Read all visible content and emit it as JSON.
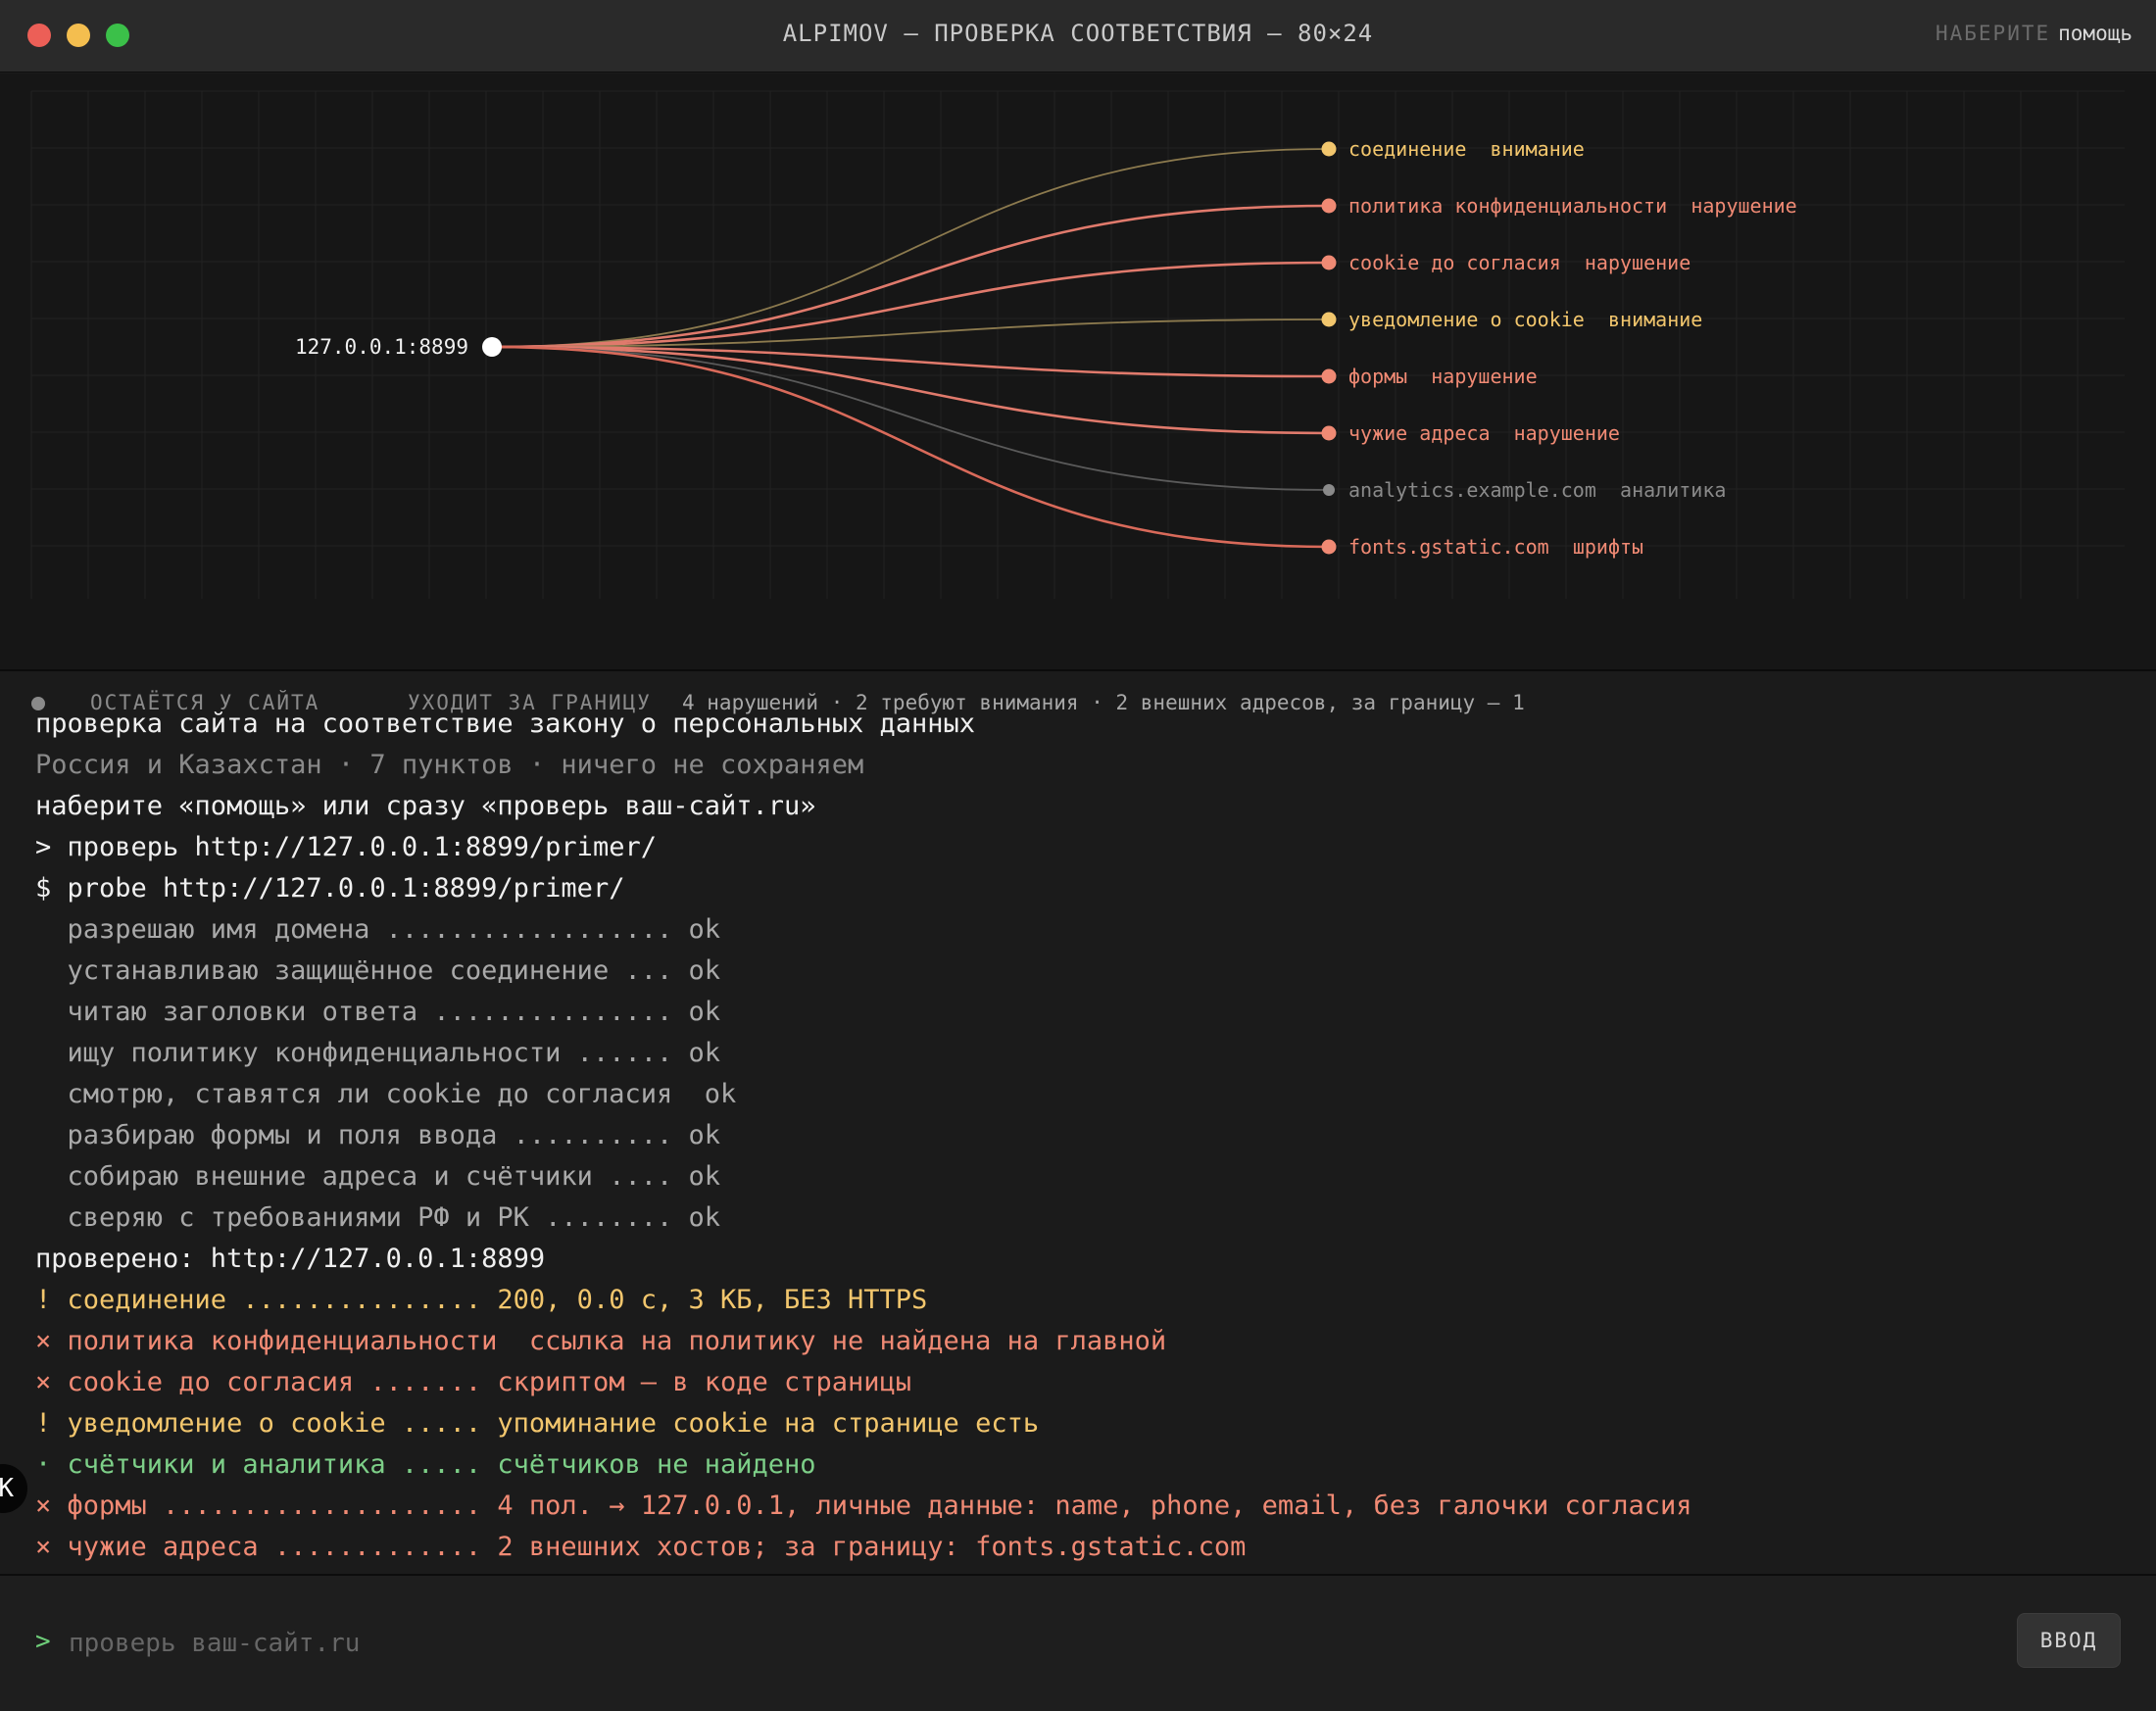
{
  "window": {
    "title": "ALPIMOV — ПРОВЕРКА СООТВЕТСТВИЯ — 80×24",
    "hint_key": "НАБЕРИТЕ",
    "hint_value": "помощь"
  },
  "colors": {
    "warn": "#f2c66d",
    "violation": "#f08a74",
    "analytics": "#8a8a8a",
    "ok": "#7dcf88",
    "root": "#ffffff"
  },
  "graph": {
    "root": "127.0.0.1:8899",
    "nodes": [
      {
        "label": "соединение",
        "status": "внимание",
        "kind": "warn"
      },
      {
        "label": "политика конфиденциальности",
        "status": "нарушение",
        "kind": "violation"
      },
      {
        "label": "cookie до согласия",
        "status": "нарушение",
        "kind": "violation"
      },
      {
        "label": "уведомление о cookie",
        "status": "внимание",
        "kind": "warn"
      },
      {
        "label": "формы",
        "status": "нарушение",
        "kind": "violation"
      },
      {
        "label": "чужие адреса",
        "status": "нарушение",
        "kind": "violation"
      },
      {
        "label": "analytics.example.com",
        "status": "аналитика",
        "kind": "analytics"
      },
      {
        "label": "fonts.gstatic.com",
        "status": "шрифты",
        "kind": "violation"
      }
    ]
  },
  "legend": {
    "stays": "ОСТАЁТСЯ У САЙТА",
    "leaves": "УХОДИТ ЗА ГРАНИЦУ",
    "summary": "4 нарушений · 2 требуют внимания · 2 внешних адресов, за границу — 1"
  },
  "console": [
    {
      "text": "проверка сайта на соответствие закону о персональных данных",
      "style": "white"
    },
    {
      "text": "Россия и Казахстан · 7 пунктов · ничего не сохраняем",
      "style": "dim"
    },
    {
      "text": "наберите «помощь» или сразу «проверь ваш-сайт.ru»",
      "style": "white"
    },
    {
      "text": "> проверь http://127.0.0.1:8899/primer/",
      "style": "white"
    },
    {
      "text": "$ probe http://127.0.0.1:8899/primer/",
      "style": "white"
    },
    {
      "text": "  разрешаю имя домена .................. ok",
      "style": "step"
    },
    {
      "text": "  устанавливаю защищённое соединение ... ok",
      "style": "step"
    },
    {
      "text": "  читаю заголовки ответа ............... ok",
      "style": "step"
    },
    {
      "text": "  ищу политику конфиденциальности ...... ok",
      "style": "step"
    },
    {
      "text": "  смотрю, ставятся ли cookie до согласия  ok",
      "style": "step"
    },
    {
      "text": "  разбираю формы и поля ввода .......... ok",
      "style": "step"
    },
    {
      "text": "  собираю внешние адреса и счётчики .... ok",
      "style": "step"
    },
    {
      "text": "  сверяю с требованиями РФ и РК ........ ok",
      "style": "step"
    },
    {
      "text": "проверено: http://127.0.0.1:8899",
      "style": "white"
    },
    {
      "text": "! соединение ............... 200, 0.0 с, 3 КБ, БЕЗ HTTPS",
      "style": "warn"
    },
    {
      "text": "× политика конфиденциальности  ссылка на политику не найдена на главной",
      "style": "err"
    },
    {
      "text": "× cookie до согласия ....... скриптом — в коде страницы",
      "style": "err"
    },
    {
      "text": "! уведомление о cookie ..... упоминание cookie на странице есть",
      "style": "warn"
    },
    {
      "text": "· счётчики и аналитика ..... счётчиков не найдено",
      "style": "ok"
    },
    {
      "text": "× формы .................... 4 пол. → 127.0.0.1, личные данные: name, phone, email, без галочки согласия",
      "style": "err"
    },
    {
      "text": "× чужие адреса ............. 2 внешних хостов; за границу: fonts.gstatic.com",
      "style": "err"
    }
  ],
  "side_badge": "K",
  "input": {
    "prompt": ">",
    "placeholder": "проверь ваш-сайт.ru",
    "button": "ВВОД"
  }
}
